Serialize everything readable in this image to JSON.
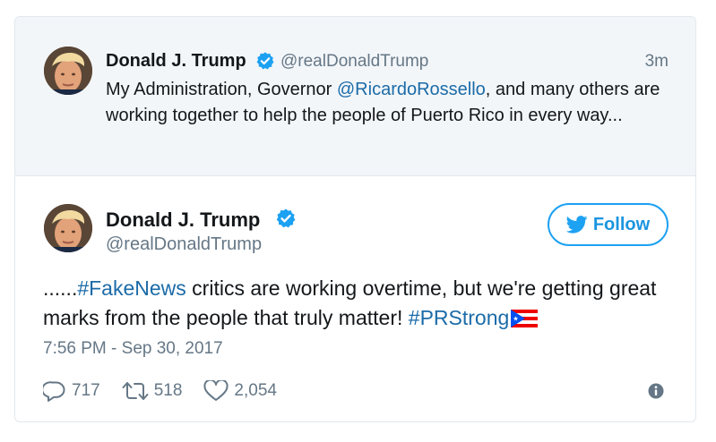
{
  "parent_tweet": {
    "author_name": "Donald J. Trump",
    "handle": "@realDonaldTrump",
    "time": "3m",
    "text_part1": "My Administration, Governor ",
    "mention": "@RicardoRossello",
    "text_part2": ", and many others are working together to help the people of Puerto Rico in every way...",
    "verified_icon": "verified-badge-icon"
  },
  "main_tweet": {
    "author_name": "Donald J. Trump",
    "handle": "@realDonaldTrump",
    "follow_label": "Follow",
    "text_part1": "......",
    "hashtag1": "#FakeNews",
    "text_part2": " critics are working overtime, but we're getting great marks from the people that truly matter! ",
    "hashtag2": "#PRStrong",
    "flag_icon": "puerto-rico-flag-icon",
    "timestamp": "7:56 PM - Sep 30, 2017",
    "stats": {
      "replies": "717",
      "retweets": "518",
      "likes": "2,054"
    }
  },
  "colors": {
    "link": "#1b6ba8",
    "twitter_blue": "#1da1f2",
    "muted": "#657786",
    "parent_bg": "#f3f6f9"
  }
}
